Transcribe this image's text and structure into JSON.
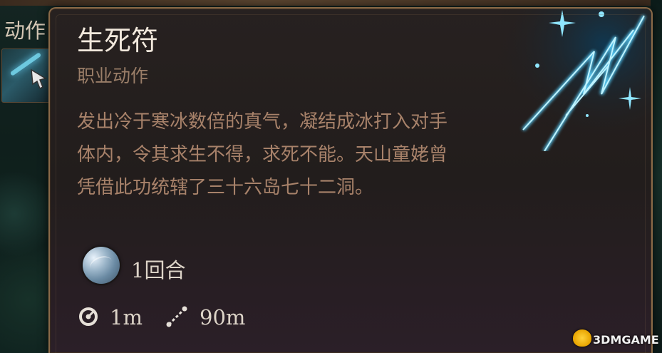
{
  "side_panel": {
    "label": "动作"
  },
  "tooltip": {
    "title": "生死符",
    "subtitle": "职业动作",
    "description": "发出冷于寒冰数倍的真气，凝结成冰打入对手体内，令其求生不得，求死不能。天山童姥曾凭借此功统辖了三十六岛七十二洞。",
    "cost": {
      "icon": "action-orb-icon",
      "label": "1回合"
    },
    "stats": [
      {
        "icon": "radius-icon",
        "value": "1m"
      },
      {
        "icon": "range-icon",
        "value": "90m"
      }
    ]
  },
  "watermark": {
    "text": "3DMGAME"
  },
  "colors": {
    "border": "#8a6a48",
    "title": "#f1e8dc",
    "subtitle": "#9a7e68",
    "description": "#a8826a",
    "spell_glow": "#6ad8ff"
  }
}
